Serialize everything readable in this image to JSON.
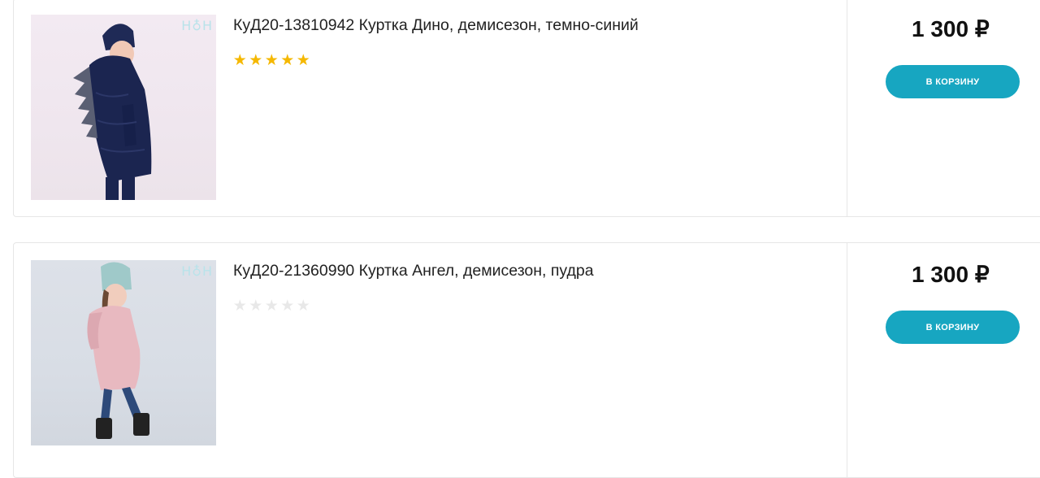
{
  "products": [
    {
      "title": "КуД20-13810942 Куртка Дино, демисезон, темно-синий",
      "rating": 5,
      "rating_max": 5,
      "price": "1 300 ₽",
      "cart_label": "В КОРЗИНУ",
      "image_watermark": "Н♁Н"
    },
    {
      "title": "КуД20-21360990 Куртка Ангел, демисезон, пудра",
      "rating": 0,
      "rating_max": 5,
      "price": "1 300 ₽",
      "cart_label": "В КОРЗИНУ",
      "image_watermark": "Н♁Н"
    }
  ],
  "colors": {
    "accent": "#17a6c1",
    "star_filled": "#f5b800",
    "star_empty": "#e8e8e8"
  }
}
